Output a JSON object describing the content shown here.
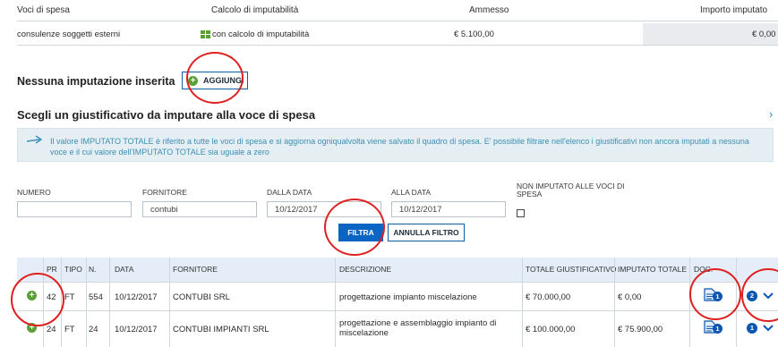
{
  "table1": {
    "headers": [
      "Voci di spesa",
      "Calcolo di imputabilità",
      "Ammesso",
      "Importo imputato"
    ],
    "row": {
      "voce": "consulenze soggetti esterni",
      "calcolo": "con calcolo di imputabilità",
      "ammesso": "€ 5.100,00",
      "importo": "€ 0,00"
    }
  },
  "imputazioni": {
    "empty_label": "Nessuna imputazione inserita",
    "add_button": "AGGIUNGI"
  },
  "giustificativo": {
    "title": "Scegli un giustificativo da imputare alla voce di spesa",
    "info": "Il valore IMPUTATO TOTALE è riferito a tutte le voci di spesa e si aggiorna ogniqualvolta viene salvato il quadro di spesa. E' possibile filtrare nell'elenco i giustificativi non ancora imputati a nessuna voce e il cui valore dell'IMPUTATO TOTALE sia uguale a zero"
  },
  "filters": {
    "numero_label": "NUMERO",
    "numero_value": "",
    "fornitore_label": "FORNITORE",
    "fornitore_value": "contubi",
    "dalla_label": "DALLA DATA",
    "dalla_value": "10/12/2017",
    "alla_label": "ALLA DATA",
    "alla_value": "10/12/2017",
    "non_imputato_label": "NON IMPUTATO ALLE VOCI DI SPESA",
    "filtra_button": "FILTRA",
    "annulla_button": "ANNULLA FILTRO"
  },
  "results": {
    "columns": [
      "PR",
      "TIPO",
      "N.",
      "DATA",
      "FORNITORE",
      "DESCRIZIONE",
      "TOTALE GIUSTIFICATIVO",
      "IMPUTATO TOTALE",
      "DOC."
    ],
    "rows": [
      {
        "pr": "42",
        "tipo": "FT",
        "n": "554",
        "data": "10/12/2017",
        "fornitore": "CONTUBI SRL",
        "descrizione": "progettazione impianto miscelazione",
        "totale": "€ 70.000,00",
        "imputato": "€ 0,00",
        "doc_count": "1",
        "voci_count": "2"
      },
      {
        "pr": "24",
        "tipo": "FT",
        "n": "24",
        "data": "10/12/2017",
        "fornitore": "CONTUBI IMPIANTI SRL",
        "descrizione": "progettazione e assemblaggio impianto di miscelazione",
        "totale": "€ 100.000,00",
        "imputato": "€ 75.900,00",
        "doc_count": "1",
        "voci_count": "1"
      }
    ]
  },
  "colors": {
    "accent": "#0b66c3",
    "green": "#5aa134",
    "highlight": "#e02020",
    "info_bg": "#e5eff3"
  }
}
